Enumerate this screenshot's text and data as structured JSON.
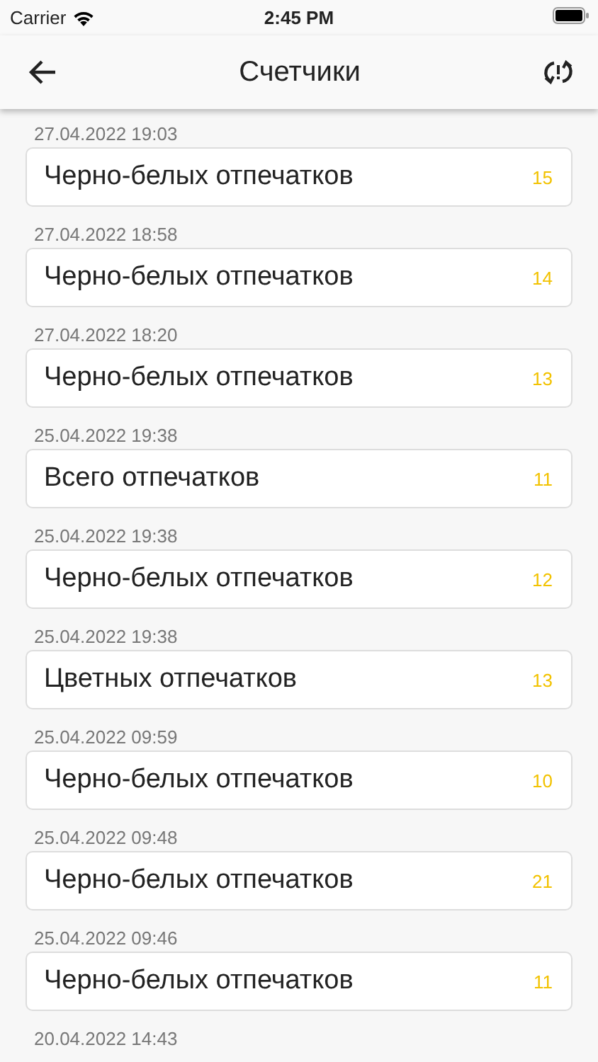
{
  "status_bar": {
    "carrier": "Carrier",
    "time": "2:45 PM"
  },
  "header": {
    "title": "Счетчики"
  },
  "entries": [
    {
      "date": "27.04.2022 19:03",
      "label": "Черно-белых отпечатков",
      "count": "15"
    },
    {
      "date": "27.04.2022 18:58",
      "label": "Черно-белых отпечатков",
      "count": "14"
    },
    {
      "date": "27.04.2022 18:20",
      "label": "Черно-белых отпечатков",
      "count": "13"
    },
    {
      "date": "25.04.2022 19:38",
      "label": "Всего отпечатков",
      "count": "11"
    },
    {
      "date": "25.04.2022 19:38",
      "label": "Черно-белых отпечатков",
      "count": "12"
    },
    {
      "date": "25.04.2022 19:38",
      "label": "Цветных отпечатков",
      "count": "13"
    },
    {
      "date": "25.04.2022 09:59",
      "label": "Черно-белых отпечатков",
      "count": "10"
    },
    {
      "date": "25.04.2022 09:48",
      "label": "Черно-белых отпечатков",
      "count": "21"
    },
    {
      "date": "25.04.2022 09:46",
      "label": "Черно-белых отпечатков",
      "count": "11"
    },
    {
      "date": "20.04.2022 14:43"
    }
  ]
}
